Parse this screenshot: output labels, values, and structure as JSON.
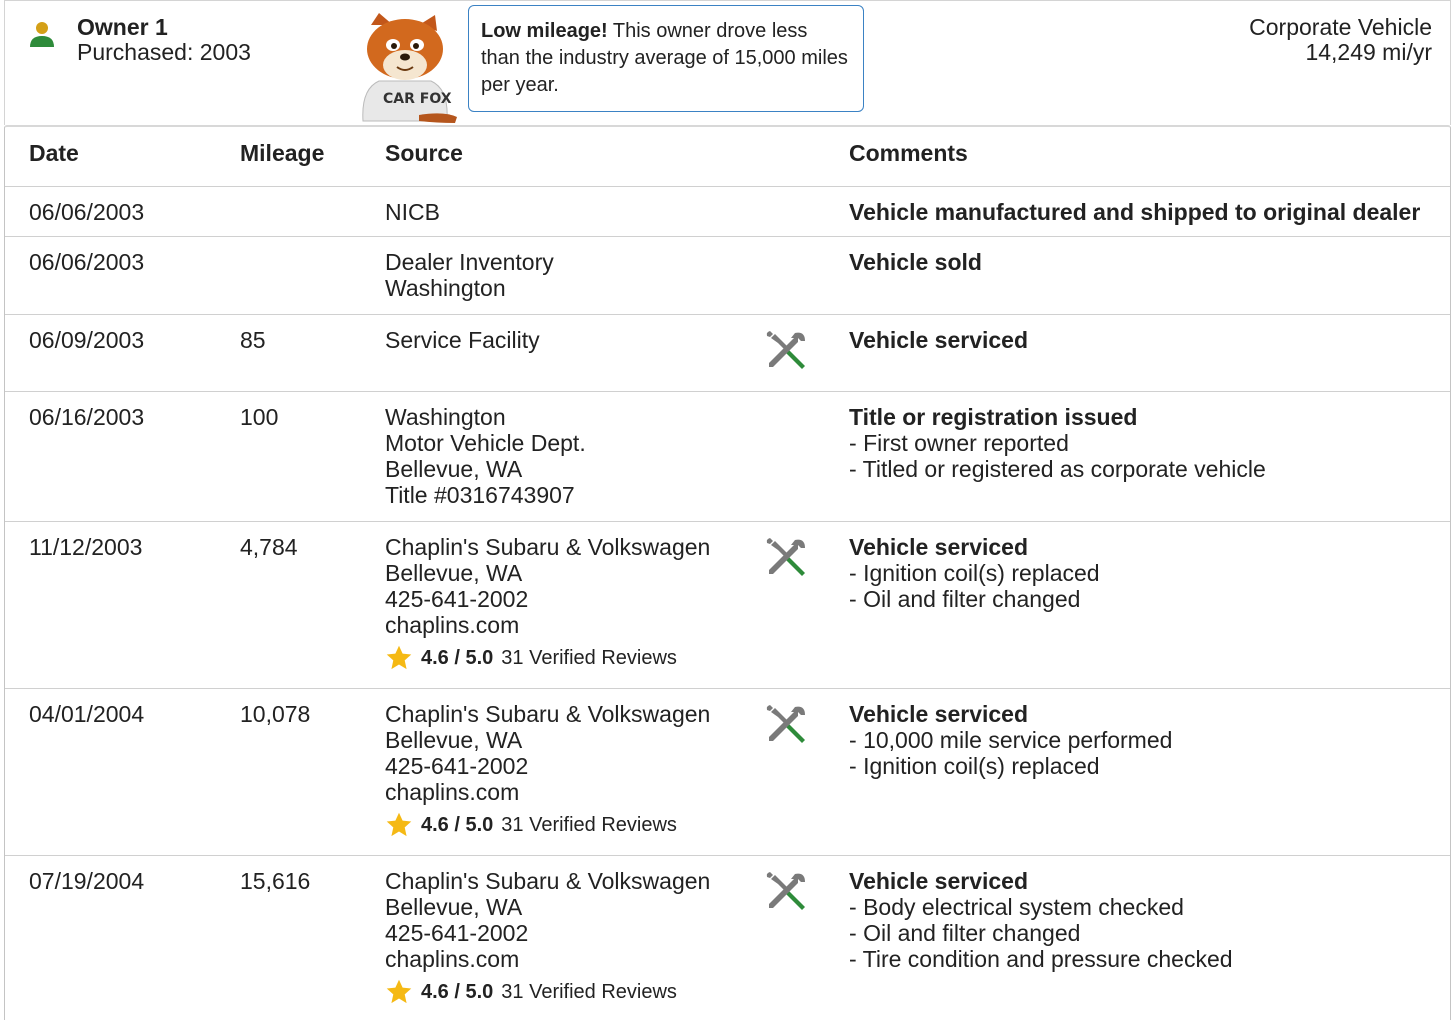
{
  "owner": {
    "title": "Owner 1",
    "purchased": "Purchased: 2003",
    "vehicle_type": "Corporate Vehicle",
    "miles_per_year": "14,249 mi/yr",
    "icon": "person-icon",
    "person_icon_color": "#2e8b3a"
  },
  "fox": {
    "shirt_text": "CAR FOX"
  },
  "callout": {
    "bold": "Low mileage!",
    "text": " This owner drove less than the industry average of 15,000 miles per year.",
    "border_color": "#3b82c4"
  },
  "table": {
    "headers": {
      "date": "Date",
      "mileage": "Mileage",
      "source": "Source",
      "comments": "Comments"
    },
    "rows": [
      {
        "date": "06/06/2003",
        "mileage": "",
        "source": [
          "NICB"
        ],
        "serviced": false,
        "comment_title": "Vehicle manufactured and shipped to original dealer",
        "comment_items": []
      },
      {
        "date": "06/06/2003",
        "mileage": "",
        "source": [
          "Dealer Inventory",
          "Washington"
        ],
        "serviced": false,
        "comment_title": "Vehicle sold",
        "comment_items": []
      },
      {
        "date": "06/09/2003",
        "mileage": "85",
        "source": [
          "Service Facility"
        ],
        "serviced": true,
        "comment_title": "Vehicle serviced",
        "comment_items": []
      },
      {
        "date": "06/16/2003",
        "mileage": "100",
        "source": [
          "Washington",
          "Motor Vehicle Dept.",
          "Bellevue, WA",
          "Title #0316743907"
        ],
        "serviced": false,
        "comment_title": "Title or registration issued",
        "comment_items": [
          "First owner reported",
          "Titled or registered as corporate vehicle"
        ]
      },
      {
        "date": "11/12/2003",
        "mileage": "4,784",
        "source": [
          "Chaplin's Subaru & Volkswagen",
          "Bellevue, WA",
          "425-641-2002",
          "chaplins.com"
        ],
        "rating": {
          "score": "4.6 / 5.0",
          "reviews": "31 Verified Reviews"
        },
        "serviced": true,
        "comment_title": "Vehicle serviced",
        "comment_items": [
          "Ignition coil(s) replaced",
          "Oil and filter changed"
        ]
      },
      {
        "date": "04/01/2004",
        "mileage": "10,078",
        "source": [
          "Chaplin's Subaru & Volkswagen",
          "Bellevue, WA",
          "425-641-2002",
          "chaplins.com"
        ],
        "rating": {
          "score": "4.6 / 5.0",
          "reviews": "31 Verified Reviews"
        },
        "serviced": true,
        "comment_title": "Vehicle serviced",
        "comment_items": [
          "10,000 mile service performed",
          "Ignition coil(s) replaced"
        ]
      },
      {
        "date": "07/19/2004",
        "mileage": "15,616",
        "source": [
          "Chaplin's Subaru & Volkswagen",
          "Bellevue, WA",
          "425-641-2002",
          "chaplins.com"
        ],
        "rating": {
          "score": "4.6 / 5.0",
          "reviews": "31 Verified Reviews"
        },
        "serviced": true,
        "comment_title": "Vehicle serviced",
        "comment_items": [
          "Body electrical system checked",
          "Oil and filter changed",
          "Tire condition and pressure checked"
        ]
      }
    ]
  },
  "icons": {
    "service": "wrench-screwdriver-icon",
    "rating": "star-icon",
    "star_color": "#f5b914",
    "service_handle_color": "#2e8b3a",
    "tool_metal_color": "#7a7a7a"
  }
}
